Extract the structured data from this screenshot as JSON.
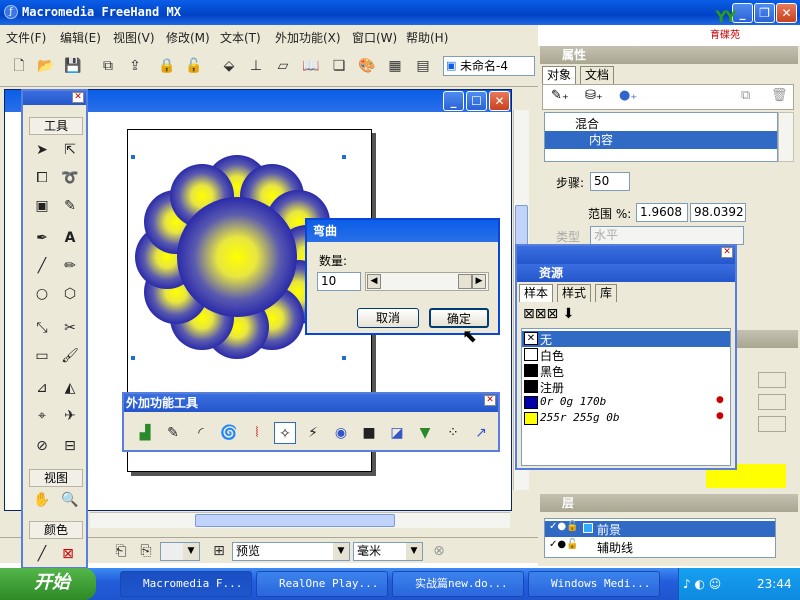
{
  "app": {
    "title": "Macromedia FreeHand MX",
    "logo_text": "育碟苑"
  },
  "menu": [
    "文件(F)",
    "编辑(E)",
    "视图(V)",
    "修改(M)",
    "文本(T)",
    "外加功能(X)",
    "窗口(W)",
    "帮助(H)"
  ],
  "document": {
    "name": "未命名-4"
  },
  "tools_panel": {
    "section_tools": "工具",
    "section_view": "视图",
    "section_color": "颜色"
  },
  "status": {
    "view_mode": "预览",
    "units": "毫米"
  },
  "properties": {
    "title": "属性",
    "tabs": [
      "对象",
      "文档"
    ],
    "tree": [
      "混合",
      "内容"
    ],
    "steps_label": "步骤:",
    "steps_value": "50",
    "range_label": "范围 %:",
    "range_start": "1.9608",
    "range_end": "98.0392",
    "type_label": "类型",
    "type_value": "水平"
  },
  "bend_dialog": {
    "title": "弯曲",
    "amount_label": "数量:",
    "amount_value": "10",
    "cancel": "取消",
    "ok": "确定"
  },
  "swatches": {
    "title": "资源",
    "tabs": [
      "样本",
      "样式",
      "库"
    ],
    "items": [
      {
        "name": "无",
        "color": "none"
      },
      {
        "name": "白色",
        "color": "#ffffff"
      },
      {
        "name": "黑色",
        "color": "#000000"
      },
      {
        "name": "注册",
        "color": "#000000"
      },
      {
        "name": "0r 0g 170b",
        "color": "#0000aa"
      },
      {
        "name": "255r 255g 0b",
        "color": "#ffff00"
      }
    ]
  },
  "addon_tools": {
    "title": "外加功能工具"
  },
  "layers": {
    "title": "层",
    "items": [
      "前景",
      "辅助线"
    ]
  },
  "taskbar": {
    "start": "开始",
    "buttons": [
      "Macromedia F...",
      "RealOne Play...",
      "实战篇new.do...",
      "Windows Medi..."
    ],
    "clock": "23:44"
  },
  "colors": {
    "accent": "#0a5ee8",
    "flower_outer": "#1a1aa8",
    "flower_center": "#ffff00"
  }
}
